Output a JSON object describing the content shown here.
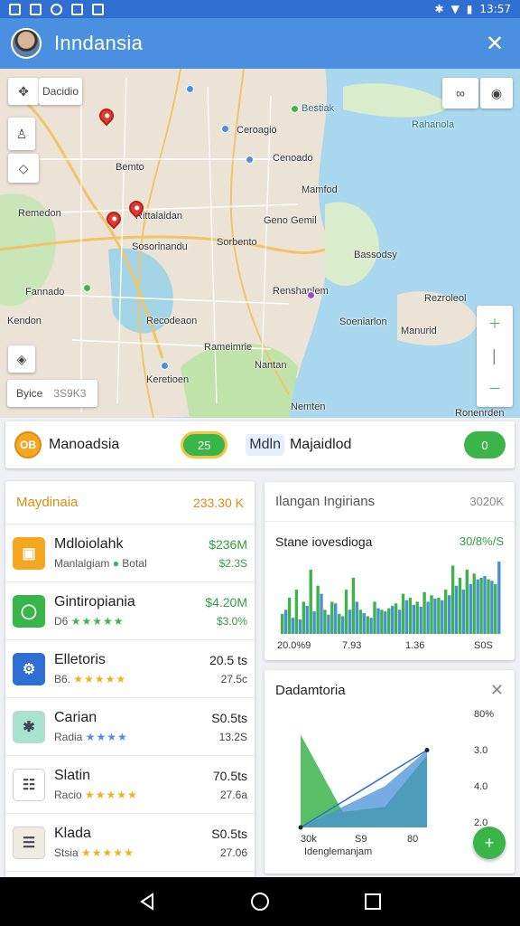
{
  "status_bar": {
    "time": "13:57"
  },
  "app_bar": {
    "title": "Inndansia"
  },
  "map": {
    "search_label": "Dacidio",
    "scale_label": "Byice",
    "scale_value": "3S9K3",
    "labels": [
      "Bestiak",
      "Rahanola",
      "Ceroagio",
      "Cenoado",
      "Bemto",
      "Rittalaidan",
      "Remedon",
      "Sorbento",
      "Geno Gemil",
      "Sosorinandu",
      "Mamfod",
      "Fannado",
      "Renshanlem",
      "Recodeaon",
      "Rameimrie",
      "Nantan",
      "Soeniarlon",
      "Kendon",
      "Keretioen",
      "Nemten",
      "Manurid",
      "Rezroleol",
      "Bassodsy",
      "Ronenrden"
    ]
  },
  "toggles": {
    "left_logo": "OB",
    "left_label": "Manoadsia",
    "left_switch": "25",
    "right_tag": "Mdln",
    "right_label": "Majaidlod",
    "right_switch": "0"
  },
  "list_panel": {
    "title": "Maydinaia",
    "total": "233.30 K",
    "items": [
      {
        "name": "Mdloiolahk",
        "sub": "Manlalgiam",
        "sub2": "Botal",
        "value": "$236M",
        "value2": "$2.3S",
        "color": "#f5a623",
        "icon": "square-icon",
        "glyph": "▣"
      },
      {
        "name": "Gintiropiania",
        "sub": "D6",
        "stars": "★★★★★",
        "value": "$4.20M",
        "value2": "$3.0%",
        "color": "#39b54a",
        "icon": "circle-icon",
        "glyph": "◯"
      },
      {
        "name": "Elletoris",
        "sub": "B6.",
        "stars": "★★★★★",
        "value": "20.5 ts",
        "value2": "27.5c",
        "color": "#2f6fd1",
        "icon": "badge-icon",
        "glyph": "⚙"
      },
      {
        "name": "Carian",
        "sub": "Radia",
        "stars": "★★★★",
        "value": "S0.5ts",
        "value2": "13.2S",
        "color": "#a8e3cf",
        "icon": "figure-icon",
        "glyph": "✱"
      },
      {
        "name": "Slatin",
        "sub": "Racio",
        "stars": "★★★★★",
        "value": "70.5ts",
        "value2": "27.6a",
        "color": "#ffffff",
        "icon": "list-icon",
        "glyph": "☷"
      },
      {
        "name": "Klada",
        "sub": "Stsia",
        "stars": "★★★★★",
        "value": "S0.5ts",
        "value2": "27.06",
        "color": "#f1ece0",
        "icon": "doc-icon",
        "glyph": "☰"
      }
    ]
  },
  "bar_panel": {
    "title": "Ilangan Ingirians",
    "value": "3020K",
    "subtitle": "Stane iovesdioga",
    "subvalue": "30/8%/S"
  },
  "area_panel": {
    "title": "Dadamtoria",
    "fab": "+"
  },
  "chart_data": [
    {
      "type": "bar",
      "title": "Stane iovesdioga",
      "x_ticks": [
        "20.0%9",
        "7.93",
        "1.36",
        "S0S"
      ],
      "series": [
        {
          "color": "#3cb44b",
          "values": [
            25,
            45,
            55,
            40,
            80,
            60,
            30,
            40,
            25,
            55,
            70,
            30,
            22,
            40,
            30,
            32,
            38,
            50,
            45,
            40,
            52,
            48,
            45,
            55,
            85,
            70,
            80,
            75,
            70,
            68,
            62
          ]
        },
        {
          "color": "#4a90d9",
          "values": [
            30,
            20,
            18,
            35,
            28,
            50,
            24,
            38,
            22,
            30,
            40,
            26,
            20,
            32,
            28,
            35,
            30,
            42,
            36,
            34,
            40,
            44,
            42,
            48,
            60,
            55,
            62,
            68,
            72,
            66,
            90
          ]
        }
      ]
    },
    {
      "type": "area",
      "title": "Dadamtoria",
      "xlabel": "Idenglemanjam",
      "x_ticks": [
        "30k",
        "S9",
        "80"
      ],
      "y_ticks": [
        "80%",
        "3.0",
        "4.0",
        "2.0"
      ],
      "series": [
        {
          "name": "",
          "color": "#3cb44b",
          "values": [
            90,
            15,
            20,
            70
          ]
        },
        {
          "name": "",
          "color": "#4a90d9",
          "values": [
            0,
            20,
            40,
            75
          ]
        }
      ]
    }
  ]
}
